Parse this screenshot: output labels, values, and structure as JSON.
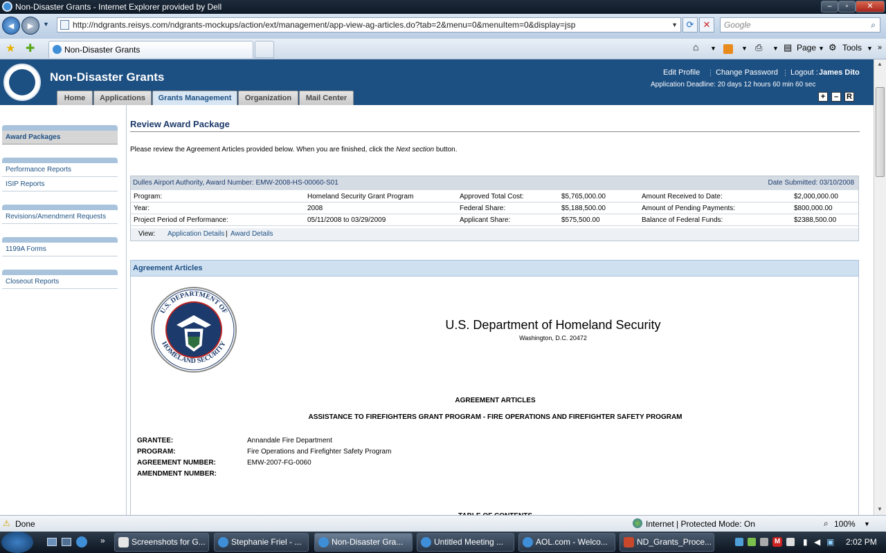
{
  "browser": {
    "window_title": "Non-Disaster Grants - Internet Explorer provided by Dell",
    "url": "http://ndgrants.reisys.com/ndgrants-mockups/action/ext/management/app-view-ag-articles.do?tab=2&menu=0&menuItem=0&display=jsp",
    "search_placeholder": "Google",
    "tab_title": "Non-Disaster Grants",
    "cmd_page": "Page",
    "cmd_tools": "Tools",
    "status_text": "Done",
    "zone_text": "Internet | Protected Mode: On",
    "zoom": "100%"
  },
  "header": {
    "app_title": "Non-Disaster Grants",
    "edit_profile": "Edit Profile",
    "change_password": "Change Password",
    "logout": "Logout :",
    "user": "James Dito",
    "deadline": "Application Deadline: 20 days 12 hours 60 min 60 sec",
    "tabs": [
      "Home",
      "Applications",
      "Grants Management",
      "Organization",
      "Mail Center"
    ],
    "active_tab": "Grants Management",
    "tools": [
      "+",
      "–",
      "R"
    ]
  },
  "sidebar": {
    "items": [
      "Award Packages",
      "Performance Reports",
      "ISIP Reports",
      "Revisions/Amendment Requests",
      "1199A Forms",
      "Closeout Reports"
    ]
  },
  "main": {
    "title": "Review Award Package",
    "intro_pre": "Please review the Agreement Articles provided below. When you are finished, click the ",
    "intro_em": "Next section",
    "intro_post": " button.",
    "award_header": "Dulles Airport Authority, Award Number: EMW-2008-HS-00060-S01",
    "date_submitted": "Date Submitted: 03/10/2008",
    "rows": [
      {
        "l1": "Program:",
        "v1": "Homeland Security Grant Program",
        "l2": "Approved Total Cost:",
        "v2": "$5,765,000.00",
        "l3": "Amount Received to Date:",
        "v3": "$2,000,000.00"
      },
      {
        "l1": "Year:",
        "v1": "2008",
        "l2": "Federal Share:",
        "v2": "$5,188,500.00",
        "l3": "Amount of Pending Payments:",
        "v3": "$800,000.00"
      },
      {
        "l1": "Project Period of Performance:",
        "v1": "05/11/2008 to 03/29/2009",
        "l2": "Applicant Share:",
        "v2": "$575,500.00",
        "l3": "Balance of Federal Funds:",
        "v3": "$2388,500.00"
      }
    ],
    "view_label": "View:",
    "view_link1": "Application Details",
    "view_link2": "Award Details",
    "agreement_header": "Agreement Articles",
    "dept_name": "U.S. Department of Homeland Security",
    "dept_address": "Washington, D.C. 20472",
    "seal_top_text": "U.S. DEPARTMENT OF",
    "seal_bottom_text": "HOMELAND SECURITY",
    "doc_title": "AGREEMENT ARTICLES",
    "doc_subtitle": "ASSISTANCE TO FIREFIGHTERS GRANT PROGRAM - FIRE OPERATIONS AND FIREFIGHTER SAFETY PROGRAM",
    "fields": [
      {
        "label": "GRANTEE:",
        "value": "Annandale Fire Department"
      },
      {
        "label": "PROGRAM:",
        "value": "Fire Operations and Firefighter Safety Program"
      },
      {
        "label": "AGREEMENT NUMBER:",
        "value": "EMW-2007-FG-0060"
      },
      {
        "label": "AMENDMENT NUMBER:",
        "value": ""
      }
    ],
    "cut_off_text": "TABLE OF CONTENTS"
  },
  "taskbar": {
    "items": [
      "Screenshots for G...",
      "Stephanie Friel - ...",
      "Non-Disaster Gra...",
      "Untitled Meeting ...",
      "AOL.com - Welco...",
      "ND_Grants_Proce..."
    ],
    "overflow": "»",
    "clock": "2:02 PM"
  },
  "colors": {
    "header_blue": "#1c4f82",
    "sidebar_accent": "#a9c3dd",
    "agreement_bar": "#cfe0f1"
  }
}
